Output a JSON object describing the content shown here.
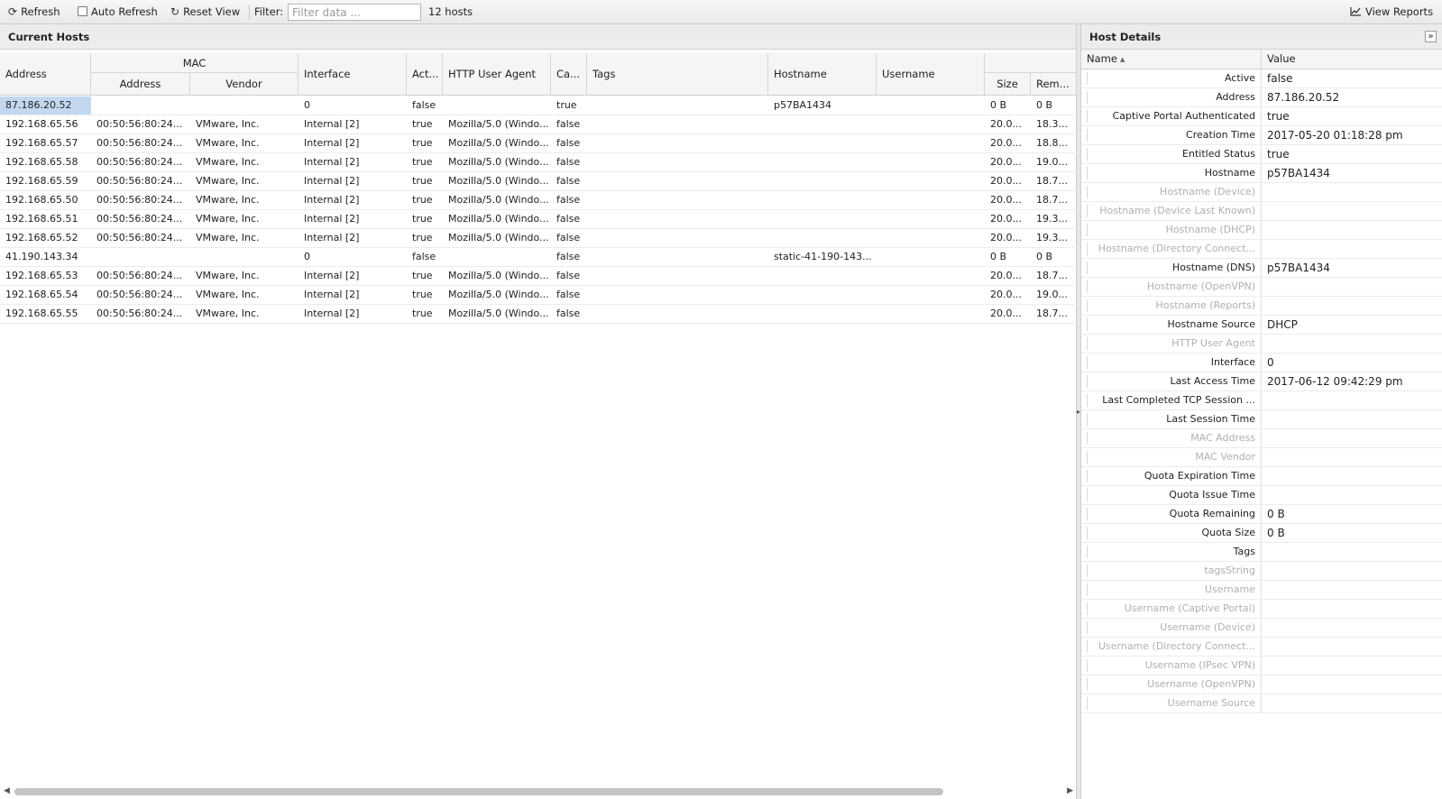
{
  "toolbar": {
    "refresh_label": "Refresh",
    "auto_refresh_label": "Auto Refresh",
    "reset_view_label": "Reset View",
    "filter_label": "Filter:",
    "filter_placeholder": "Filter data ...",
    "count_label": "12 hosts",
    "view_reports_label": "View Reports"
  },
  "icons": {
    "refresh": "refresh-icon",
    "reset": "reset-view-icon",
    "reports": "chart-line-icon",
    "collapse": "double-chevron-right-icon"
  },
  "hosts_panel": {
    "title": "Current Hosts",
    "columns": {
      "address": "Address",
      "mac_group": "MAC",
      "mac_address": "Address",
      "mac_vendor": "Vendor",
      "interface": "Interface",
      "active": "Act...",
      "user_agent": "HTTP User Agent",
      "captive": "Ca...",
      "tags": "Tags",
      "hostname": "Hostname",
      "username": "Username",
      "size": "Size",
      "remaining": "Rem..."
    },
    "rows": [
      [
        "87.186.20.52",
        "",
        "",
        "0",
        "false",
        "",
        "true",
        "",
        "p57BA1434",
        "",
        "0 B",
        "0 B"
      ],
      [
        "192.168.65.56",
        "00:50:56:80:24...",
        "VMware, Inc.",
        "Internal [2]",
        "true",
        "Mozilla/5.0 (Windo...",
        "false",
        "",
        "",
        "",
        "20.0...",
        "18.3..."
      ],
      [
        "192.168.65.57",
        "00:50:56:80:24...",
        "VMware, Inc.",
        "Internal [2]",
        "true",
        "Mozilla/5.0 (Windo...",
        "false",
        "",
        "",
        "",
        "20.0...",
        "18.8..."
      ],
      [
        "192.168.65.58",
        "00:50:56:80:24...",
        "VMware, Inc.",
        "Internal [2]",
        "true",
        "Mozilla/5.0 (Windo...",
        "false",
        "",
        "",
        "",
        "20.0...",
        "19.0..."
      ],
      [
        "192.168.65.59",
        "00:50:56:80:24...",
        "VMware, Inc.",
        "Internal [2]",
        "true",
        "Mozilla/5.0 (Windo...",
        "false",
        "",
        "",
        "",
        "20.0...",
        "18.7..."
      ],
      [
        "192.168.65.50",
        "00:50:56:80:24...",
        "VMware, Inc.",
        "Internal [2]",
        "true",
        "Mozilla/5.0 (Windo...",
        "false",
        "",
        "",
        "",
        "20.0...",
        "18.7..."
      ],
      [
        "192.168.65.51",
        "00:50:56:80:24...",
        "VMware, Inc.",
        "Internal [2]",
        "true",
        "Mozilla/5.0 (Windo...",
        "false",
        "",
        "",
        "",
        "20.0...",
        "19.3..."
      ],
      [
        "192.168.65.52",
        "00:50:56:80:24...",
        "VMware, Inc.",
        "Internal [2]",
        "true",
        "Mozilla/5.0 (Windo...",
        "false",
        "",
        "",
        "",
        "20.0...",
        "19.3..."
      ],
      [
        "41.190.143.34",
        "",
        "",
        "0",
        "false",
        "",
        "false",
        "",
        "static-41-190-143...",
        "",
        "0 B",
        "0 B"
      ],
      [
        "192.168.65.53",
        "00:50:56:80:24...",
        "VMware, Inc.",
        "Internal [2]",
        "true",
        "Mozilla/5.0 (Windo...",
        "false",
        "",
        "",
        "",
        "20.0...",
        "18.7..."
      ],
      [
        "192.168.65.54",
        "00:50:56:80:24...",
        "VMware, Inc.",
        "Internal [2]",
        "true",
        "Mozilla/5.0 (Windo...",
        "false",
        "",
        "",
        "",
        "20.0...",
        "19.0..."
      ],
      [
        "192.168.65.55",
        "00:50:56:80:24...",
        "VMware, Inc.",
        "Internal [2]",
        "true",
        "Mozilla/5.0 (Windo...",
        "false",
        "",
        "",
        "",
        "20.0...",
        "18.7..."
      ]
    ]
  },
  "details_panel": {
    "title": "Host Details",
    "name_header": "Name",
    "value_header": "Value",
    "rows": [
      {
        "name": "Active",
        "value": "false",
        "dim": false
      },
      {
        "name": "Address",
        "value": "87.186.20.52",
        "dim": false
      },
      {
        "name": "Captive Portal Authenticated",
        "value": "true",
        "dim": false
      },
      {
        "name": "Creation Time",
        "value": "2017-05-20 01:18:28 pm",
        "dim": false
      },
      {
        "name": "Entitled Status",
        "value": "true",
        "dim": false
      },
      {
        "name": "Hostname",
        "value": "p57BA1434",
        "dim": false
      },
      {
        "name": "Hostname (Device)",
        "value": "",
        "dim": true
      },
      {
        "name": "Hostname (Device Last Known)",
        "value": "",
        "dim": true
      },
      {
        "name": "Hostname (DHCP)",
        "value": "",
        "dim": true
      },
      {
        "name": "Hostname (Directory Connect...",
        "value": "",
        "dim": true
      },
      {
        "name": "Hostname (DNS)",
        "value": "p57BA1434",
        "dim": false
      },
      {
        "name": "Hostname (OpenVPN)",
        "value": "",
        "dim": true
      },
      {
        "name": "Hostname (Reports)",
        "value": "",
        "dim": true
      },
      {
        "name": "Hostname Source",
        "value": "DHCP",
        "dim": false
      },
      {
        "name": "HTTP User Agent",
        "value": "",
        "dim": true
      },
      {
        "name": "Interface",
        "value": "0",
        "dim": false
      },
      {
        "name": "Last Access Time",
        "value": "2017-06-12 09:42:29 pm",
        "dim": false
      },
      {
        "name": "Last Completed TCP Session ...",
        "value": "",
        "dim": false
      },
      {
        "name": "Last Session Time",
        "value": "",
        "dim": false
      },
      {
        "name": "MAC Address",
        "value": "",
        "dim": true
      },
      {
        "name": "MAC Vendor",
        "value": "",
        "dim": true
      },
      {
        "name": "Quota Expiration Time",
        "value": "",
        "dim": false
      },
      {
        "name": "Quota Issue Time",
        "value": "",
        "dim": false
      },
      {
        "name": "Quota Remaining",
        "value": "0 B",
        "dim": false
      },
      {
        "name": "Quota Size",
        "value": "0 B",
        "dim": false
      },
      {
        "name": "Tags",
        "value": "",
        "dim": false
      },
      {
        "name": "tagsString",
        "value": "",
        "dim": true
      },
      {
        "name": "Username",
        "value": "",
        "dim": true
      },
      {
        "name": "Username (Captive Portal)",
        "value": "",
        "dim": true
      },
      {
        "name": "Username (Device)",
        "value": "",
        "dim": true
      },
      {
        "name": "Username (Directory Connect...",
        "value": "",
        "dim": true
      },
      {
        "name": "Username (IPsec VPN)",
        "value": "",
        "dim": true
      },
      {
        "name": "Username (OpenVPN)",
        "value": "",
        "dim": true
      },
      {
        "name": "Username Source",
        "value": "",
        "dim": true
      }
    ]
  },
  "colors": {
    "selected_row": "#c3d8f0",
    "dim_text": "#b0b0b0"
  }
}
